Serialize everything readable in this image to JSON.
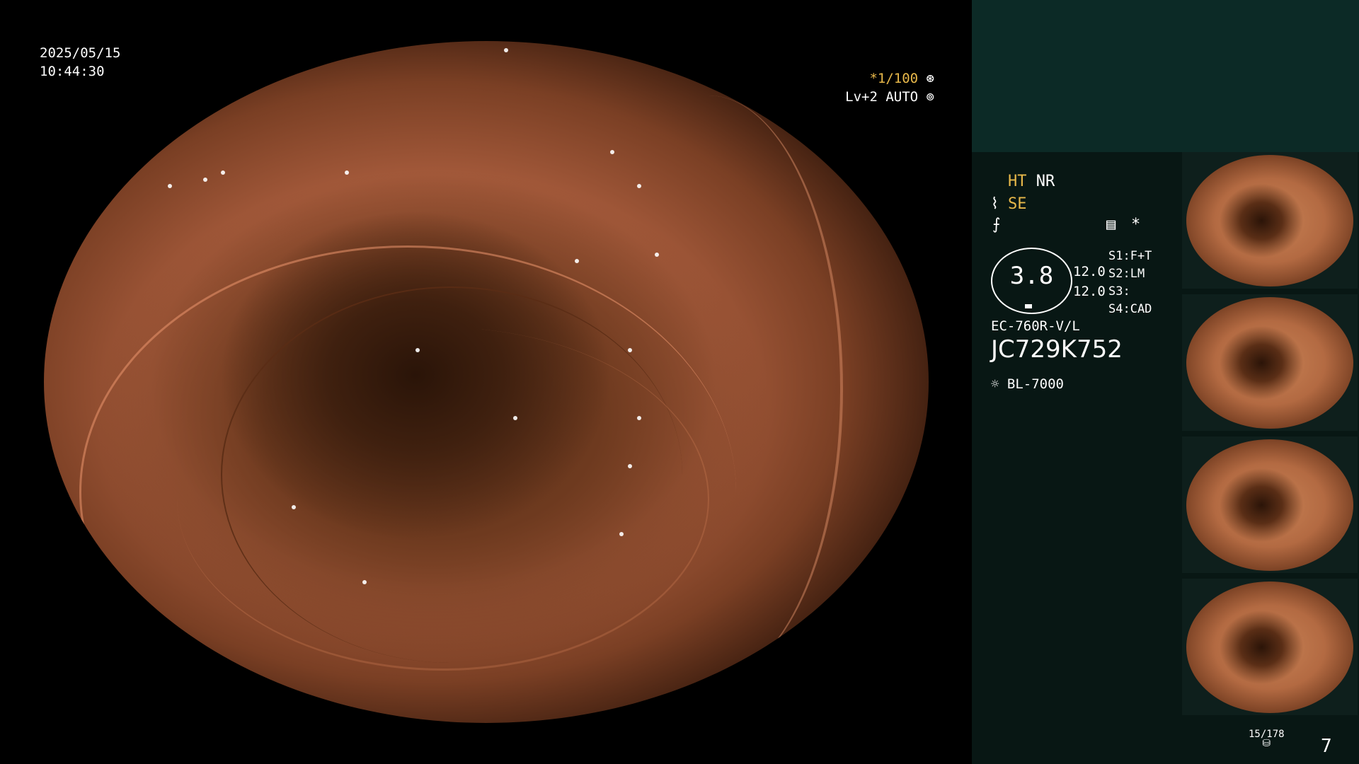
{
  "overlay": {
    "date": "2025/05/15",
    "time": "10:44:30",
    "shutter": "*1/100",
    "level": "Lv+2 AUTO"
  },
  "settings": {
    "ht": "HT",
    "nr": "NR",
    "se": "SE",
    "zoom": "3.8",
    "value_a": "12.0",
    "value_b": "12.0",
    "s1": "S1:F+T",
    "s2": "S2:LM",
    "s3": "S3:",
    "s4": "S4:CAD",
    "scope_model": "EC-760R-V/L",
    "serial": "JC729K752",
    "light_source": "BL-7000",
    "asterisk": "*"
  },
  "footer": {
    "capture_count": "15/178",
    "page": "7"
  },
  "colors": {
    "accent_gold": "#e8b84a",
    "panel_top": "#0c2a26",
    "panel": "#081714"
  },
  "icons": [
    "shutter-wheel-icon",
    "auto-iris-icon",
    "enhance-icon",
    "freeze-icon",
    "record-icon",
    "light-source-icon",
    "storage-icon"
  ]
}
